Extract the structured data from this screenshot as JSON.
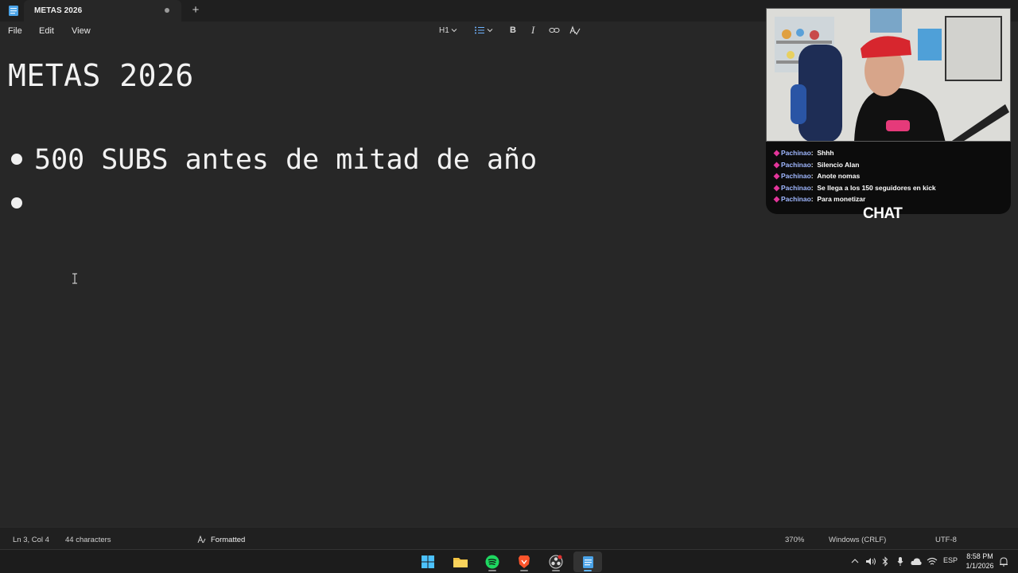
{
  "tab": {
    "title": "METAS 2026",
    "add_symbol": "+"
  },
  "menu": {
    "file": "File",
    "edit": "Edit",
    "view": "View"
  },
  "toolbar": {
    "heading": "H1",
    "bold": "B",
    "italic": "I"
  },
  "document": {
    "title": "METAS 2026",
    "bullets": [
      "500 SUBS antes de mitad de año",
      ""
    ]
  },
  "chat": {
    "label": "CHAT",
    "messages": [
      {
        "user": "Pachinao",
        "text": "Shhh"
      },
      {
        "user": "Pachinao",
        "text": "Silencio Alan"
      },
      {
        "user": "Pachinao",
        "text": "Anote nomas"
      },
      {
        "user": "Pachinao",
        "text": "Se llega a los 150 seguidores en kick"
      },
      {
        "user": "Pachinao",
        "text": "Para monetizar"
      }
    ]
  },
  "status": {
    "position": "Ln 3, Col 4",
    "characters": "44 characters",
    "format": "Formatted",
    "zoom": "370%",
    "line_endings": "Windows (CRLF)",
    "encoding": "UTF-8"
  },
  "taskbar": {
    "language": "ESP",
    "time": "8:58 PM",
    "date": "1/1/2026"
  },
  "colors": {
    "accent": "#5fb2f2",
    "chat_user": "#9fb7ff",
    "badge": "#e3359a"
  }
}
